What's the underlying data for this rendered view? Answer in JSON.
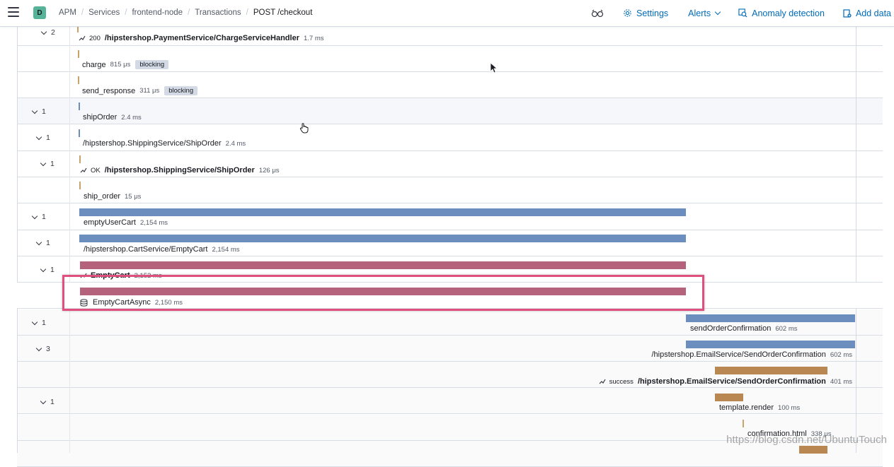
{
  "header": {
    "space_initial": "D",
    "breadcrumbs": [
      "APM",
      "Services",
      "frontend-node",
      "Transactions",
      "POST /checkout"
    ],
    "settings_label": "Settings",
    "alerts_label": "Alerts",
    "anomaly_label": "Anomaly detection",
    "add_data_label": "Add data",
    "icons": {
      "menu": "hamburger-menu-icon",
      "inspect": "glasses-icon",
      "settings": "gear-icon",
      "alerts": "chevron-down-icon",
      "anomaly": "anomaly-detection-icon",
      "add_data": "add-data-icon"
    }
  },
  "waterfall": {
    "rows": [
      {
        "count": "2",
        "status": "200",
        "name": "/hipstershop.PaymentService/ChargeServiceHandler",
        "duration": "1.7 ms",
        "bold": true,
        "kind": "transaction"
      },
      {
        "count": "",
        "name": "charge",
        "duration": "815 μs",
        "badge": "blocking",
        "kind": "span"
      },
      {
        "count": "",
        "name": "send_response",
        "duration": "311 μs",
        "badge": "blocking",
        "kind": "span"
      },
      {
        "count": "1",
        "name": "shipOrder",
        "duration": "2.4 ms",
        "kind": "span"
      },
      {
        "count": "1",
        "name": "/hipstershop.ShippingService/ShipOrder",
        "duration": "2.4 ms",
        "kind": "span"
      },
      {
        "count": "1",
        "status": "OK",
        "name": "/hipstershop.ShippingService/ShipOrder",
        "duration": "126 μs",
        "bold": true,
        "kind": "transaction"
      },
      {
        "count": "",
        "name": "ship_order",
        "duration": "15 μs",
        "kind": "span"
      },
      {
        "count": "1",
        "name": "emptyUserCart",
        "duration": "2,154 ms",
        "kind": "span"
      },
      {
        "count": "1",
        "name": "/hipstershop.CartService/EmptyCart",
        "duration": "2,154 ms",
        "kind": "span"
      },
      {
        "count": "1",
        "name": "EmptyCart",
        "duration": "2,152 ms",
        "bold": true,
        "kind": "transaction"
      },
      {
        "count": "",
        "name": "EmptyCartAsync",
        "duration": "2,150 ms",
        "kind": "db"
      },
      {
        "count": "1",
        "name": "sendOrderConfirmation",
        "duration": "602 ms",
        "kind": "span"
      },
      {
        "count": "3",
        "name": "/hipstershop.EmailService/SendOrderConfirmation",
        "duration": "602 ms",
        "kind": "span"
      },
      {
        "count": "",
        "status": "success",
        "name": "/hipstershop.EmailService/SendOrderConfirmation",
        "duration": "401 ms",
        "bold": true,
        "kind": "transaction"
      },
      {
        "count": "1",
        "name": "template.render",
        "duration": "100 ms",
        "kind": "span"
      },
      {
        "count": "",
        "name": "confirmation.html",
        "duration": "338 μs",
        "kind": "span"
      }
    ]
  },
  "watermark": "https://blog.csdn.net/UbuntuTouch"
}
